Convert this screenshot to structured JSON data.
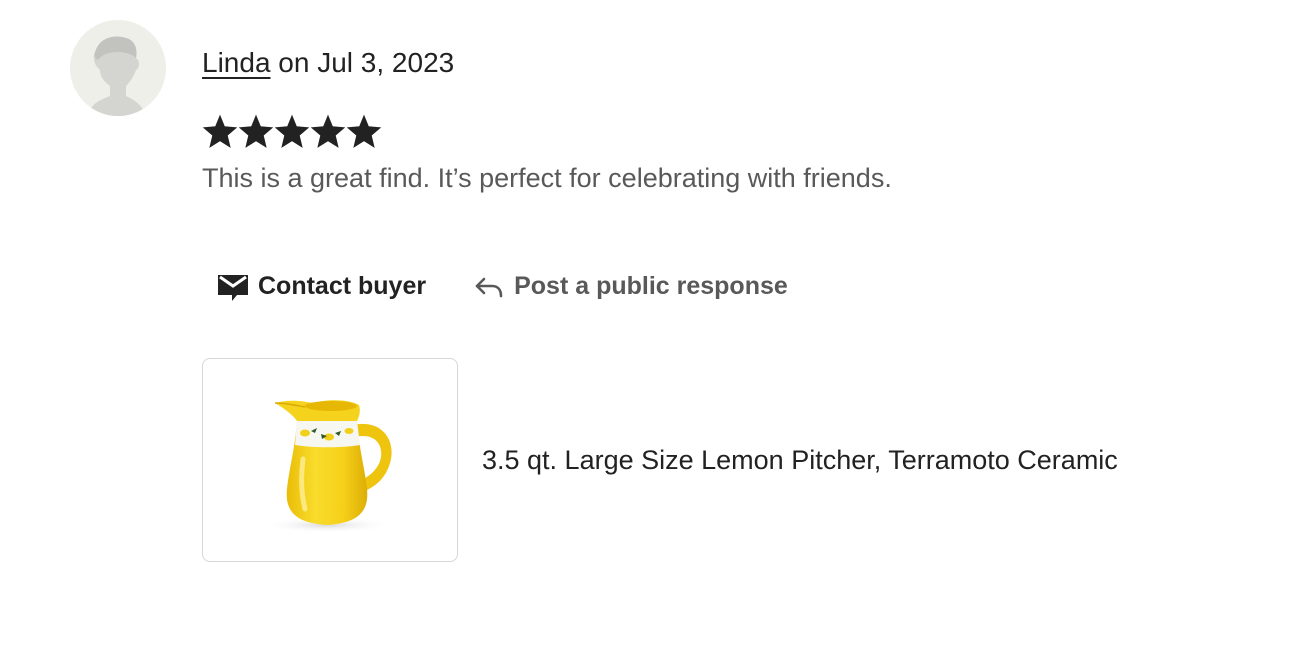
{
  "review": {
    "reviewer_name": "Linda",
    "date_prefix": " on ",
    "date": "Jul 3, 2023",
    "rating": 5,
    "rating_max": 5,
    "text": "This is a great find. It’s perfect for celebrating with friends.",
    "avatar_icon": "default-user-silhouette-icon"
  },
  "actions": {
    "contact_label": "Contact buyer",
    "contact_icon": "mail-icon",
    "respond_label": "Post a public response",
    "respond_icon": "reply-arrow-icon"
  },
  "listing": {
    "title": "3.5 qt. Large Size Lemon Pitcher, Terramoto Ceramic",
    "thumbnail_icon": "yellow-lemon-pitcher-image"
  },
  "colors": {
    "star": "#222222",
    "secondary_text": "#595959",
    "pitcher_yellow": "#f5d31c",
    "avatar_bg": "#eeefe9"
  }
}
